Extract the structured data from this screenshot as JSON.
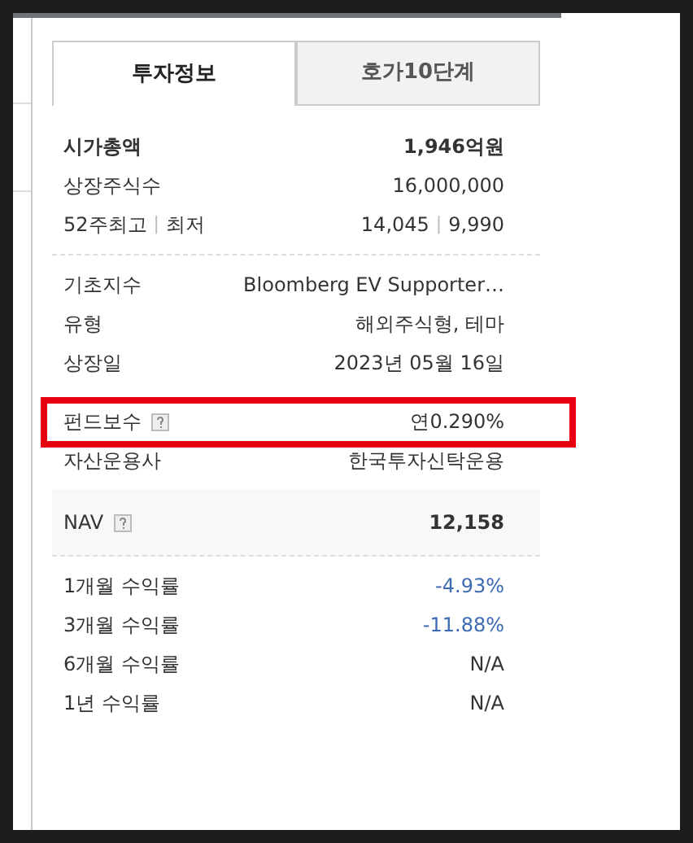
{
  "tabs": [
    {
      "label": "투자정보",
      "selected": true
    },
    {
      "label": "호가10단계",
      "selected": false
    }
  ],
  "sections": [
    {
      "kind": "divided",
      "rows": [
        {
          "label": "시가총액",
          "label_bold": true,
          "value": "1,946억원",
          "bold": true
        },
        {
          "label": "상장주식수",
          "value": "16,000,000"
        },
        {
          "label": "52주최고",
          "separator": "|",
          "label_2": "최저",
          "value": "14,045",
          "separator_2": "|",
          "value_2": "9,990"
        }
      ]
    },
    {
      "kind": "plain",
      "rows": [
        {
          "label": "기초지수",
          "value": "Bloomberg EV Supporter…"
        },
        {
          "label": "유형",
          "value": "해외주식형, 테마"
        },
        {
          "label": "상장일",
          "value": "2023년 05월 16일"
        }
      ]
    },
    {
      "kind": "plain",
      "rows": [
        {
          "label": "펀드보수",
          "help": true,
          "highlighted": true,
          "value": "연0.290%"
        },
        {
          "label": "자산운용사",
          "value": "한국투자신탁운용"
        }
      ]
    },
    {
      "kind": "shaded",
      "rows": [
        {
          "label": "NAV",
          "help": true,
          "value": "12,158",
          "bold": true
        }
      ]
    },
    {
      "kind": "plain",
      "rows": [
        {
          "label": "1개월 수익률",
          "value": "-4.93%",
          "color": "#3d6bb3"
        },
        {
          "label": "3개월 수익률",
          "value": "-11.88%",
          "color": "#3d6bb3"
        },
        {
          "label": "6개월 수익률",
          "value": "N/A",
          "color": "#333333"
        },
        {
          "label": "1년 수익률",
          "value": "N/A",
          "color": "#333333"
        }
      ]
    }
  ]
}
